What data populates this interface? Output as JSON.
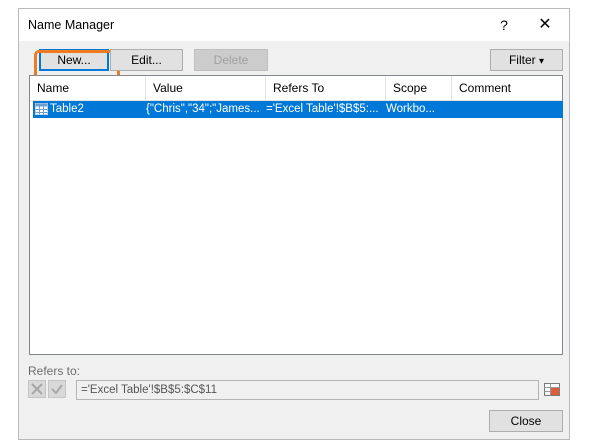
{
  "dialog": {
    "title": "Name Manager",
    "help_label": "?",
    "close_glyph": "✕"
  },
  "toolbar": {
    "new_label": "New...",
    "edit_label": "Edit...",
    "delete_label": "Delete",
    "filter_label": "Filter",
    "filter_arrow": "▾"
  },
  "columns": [
    "Name",
    "Value",
    "Refers To",
    "Scope",
    "Comment"
  ],
  "rows": [
    {
      "name": "Table2",
      "value": "{\"Chris\",\"34\";\"James...",
      "refers_to": "='Excel Table'!$B$5:...",
      "scope": "Workbo...",
      "comment": "",
      "icon": "table-icon",
      "selected": true
    }
  ],
  "refers": {
    "label": "Refers to:",
    "value": "='Excel Table'!$B$5:$C$11"
  },
  "footer": {
    "close_label": "Close"
  },
  "colors": {
    "selection": "#0078d7",
    "highlight": "#f07a22"
  }
}
